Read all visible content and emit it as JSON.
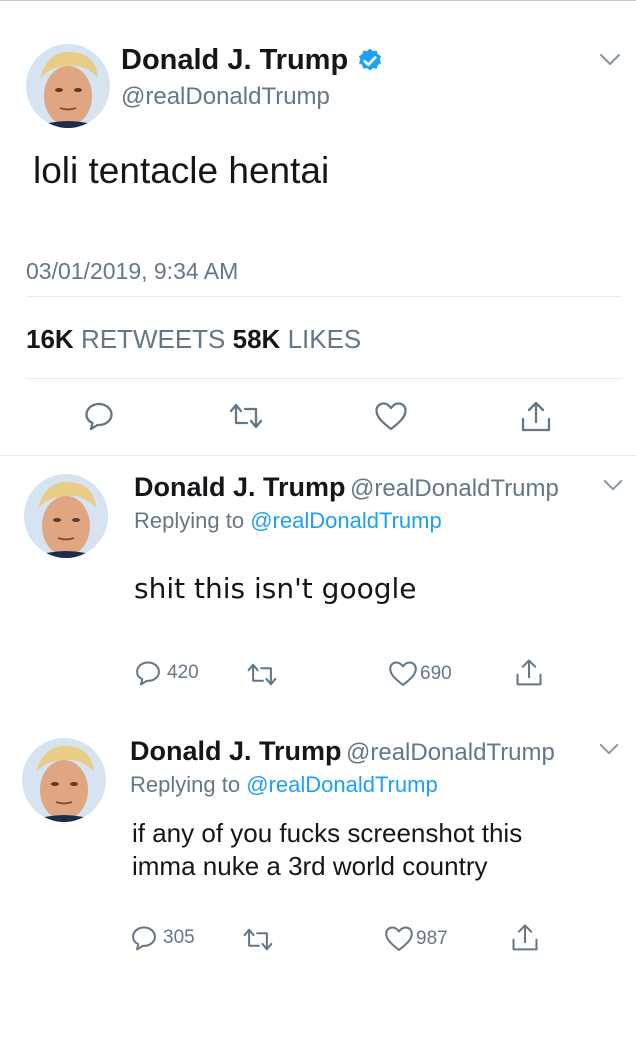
{
  "main_tweet": {
    "author_name": "Donald J. Trump",
    "handle": "@realDonaldTrump",
    "text": "loli tentacle hentai",
    "timestamp": "03/01/2019, 9:34 AM",
    "retweets_count": "16K",
    "retweets_label": "RETWEETS",
    "likes_count": "58K",
    "likes_label": "LIKES",
    "icons": [
      "reply-icon",
      "retweet-icon",
      "like-icon",
      "share-icon"
    ]
  },
  "replies": [
    {
      "author_name": "Donald J. Trump",
      "handle": "@realDonaldTrump",
      "replying_prefix": "Replying to",
      "replying_handle": "@realDonaldTrump",
      "text": "shit this isn't google",
      "reply_count": "420",
      "like_count": "690"
    },
    {
      "author_name": "Donald J. Trump",
      "handle": "@realDonaldTrump",
      "replying_prefix": "Replying to",
      "replying_handle": "@realDonaldTrump",
      "text_line1": "if any of you fucks screenshot this",
      "text_line2": "imma nuke a 3rd world country",
      "reply_count": "305",
      "like_count": "987"
    }
  ],
  "colors": {
    "text": "#14171a",
    "muted": "#657786",
    "link": "#1da1f2",
    "verified": "#1da1f2",
    "divider": "#e6ecf0"
  }
}
